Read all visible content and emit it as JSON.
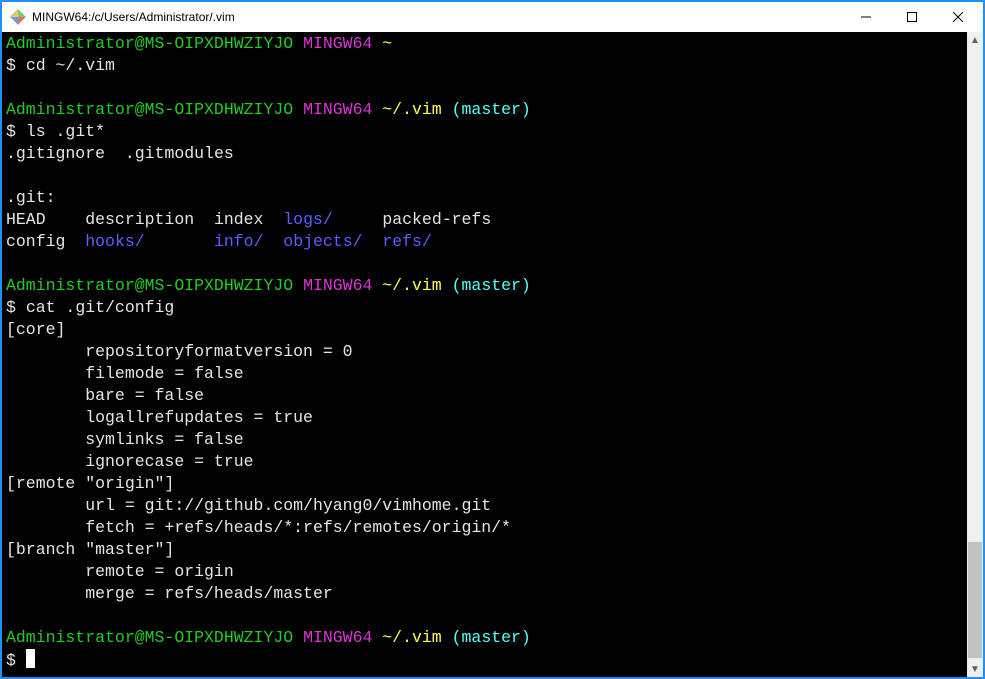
{
  "window": {
    "title": "MINGW64:/c/Users/Administrator/.vim",
    "min": "—",
    "max": "□",
    "close": "✕"
  },
  "c": {
    "green1": "#22cc22",
    "magenta": "#d836d8",
    "yellow": "#ffff55",
    "cyan": "#55ffff",
    "blue": "#5c5cff",
    "white": "#e5e5e5",
    "bg": "#000000"
  },
  "prompt": {
    "userhost": "Administrator@MS-OIPXDHWZIYJO",
    "shell": "MINGW64",
    "path_home": "~",
    "path_vim": "~/.vim",
    "branch": "(master)",
    "ps1": "$"
  },
  "cmds": {
    "cd": "cd ~/.vim",
    "ls": "ls .git*",
    "cat": "cat .git/config"
  },
  "ls_out": {
    "row1a": ".gitignore",
    "row1b": ".gitmodules",
    "git_header": ".git:",
    "r2_head": "HEAD",
    "r2_desc": "description",
    "r2_index": "index",
    "r2_logs": "logs/",
    "r2_packed": "packed-refs",
    "r3_config": "config",
    "r3_hooks": "hooks/",
    "r3_info": "info/",
    "r3_objects": "objects/",
    "r3_refs": "refs/"
  },
  "cat_out": {
    "l0": "[core]",
    "l1": "        repositoryformatversion = 0",
    "l2": "        filemode = false",
    "l3": "        bare = false",
    "l4": "        logallrefupdates = true",
    "l5": "        symlinks = false",
    "l6": "        ignorecase = true",
    "l7": "[remote \"origin\"]",
    "l8": "        url = git://github.com/hyang0/vimhome.git",
    "l9": "        fetch = +refs/heads/*:refs/remotes/origin/*",
    "l10": "[branch \"master\"]",
    "l11": "        remote = origin",
    "l12": "        merge = refs/heads/master"
  },
  "scrollbar": {
    "thumb_top_pct": 79,
    "thumb_height_pct": 18
  }
}
